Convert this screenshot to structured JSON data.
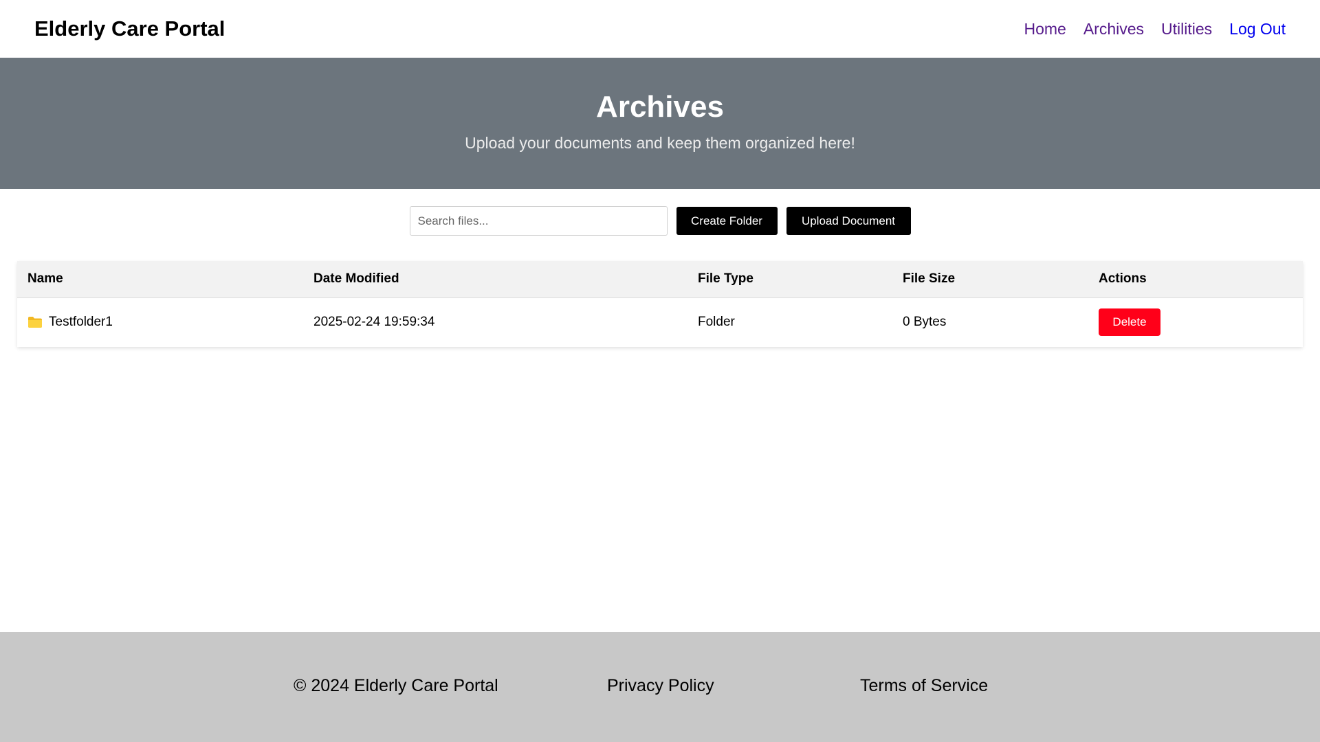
{
  "header": {
    "brand": "Elderly Care Portal",
    "nav": [
      {
        "label": "Home"
      },
      {
        "label": "Archives"
      },
      {
        "label": "Utilities"
      },
      {
        "label": "Log Out"
      }
    ]
  },
  "hero": {
    "title": "Archives",
    "subtitle": "Upload your documents and keep them organized here!"
  },
  "toolbar": {
    "search_placeholder": "Search files...",
    "create_folder_label": "Create Folder",
    "upload_label": "Upload Document"
  },
  "table": {
    "columns": [
      "Name",
      "Date Modified",
      "File Type",
      "File Size",
      "Actions"
    ],
    "rows": [
      {
        "icon": "folder-icon",
        "name": "Testfolder1",
        "date_modified": "2025-02-24 19:59:34",
        "file_type": "Folder",
        "file_size": "0 Bytes",
        "action_label": "Delete"
      }
    ]
  },
  "footer": {
    "copyright": "© 2024 Elderly Care Portal",
    "privacy": "Privacy Policy",
    "terms": "Terms of Service"
  },
  "colors": {
    "hero_bg": "#6c757d",
    "footer_bg": "#c8c8c8",
    "delete_button": "#ff0019",
    "primary_button": "#000000",
    "visited_link": "#551a8b",
    "link": "#0000ee"
  }
}
